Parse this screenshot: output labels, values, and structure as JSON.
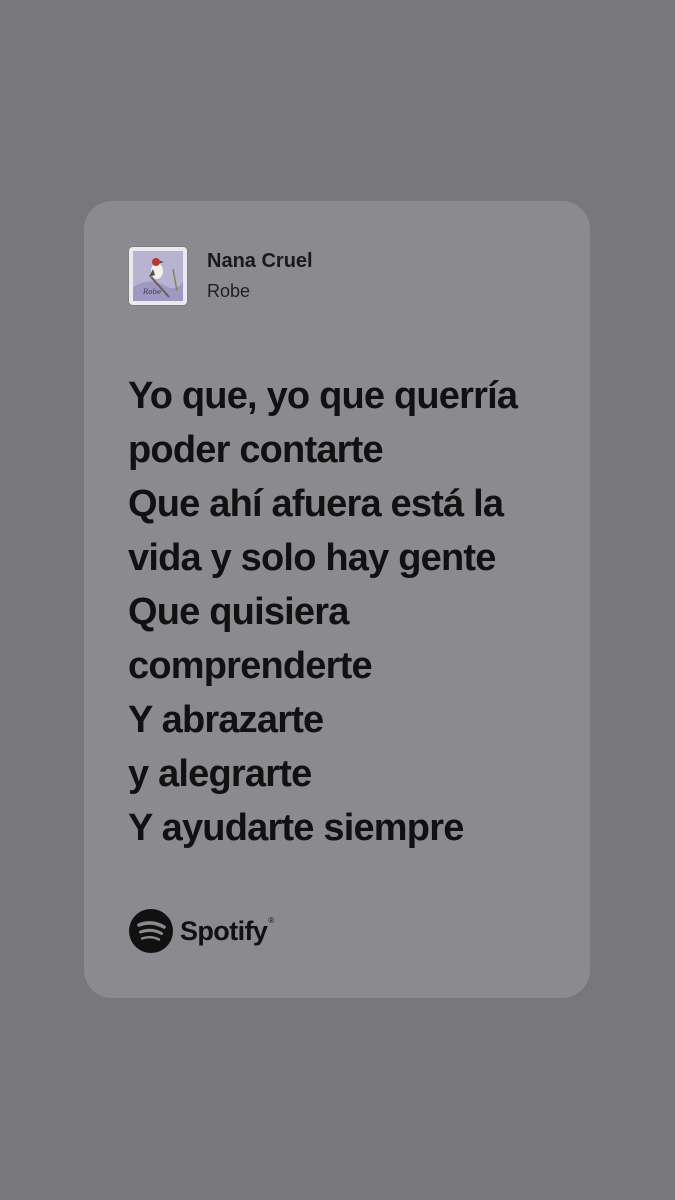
{
  "song": {
    "title": "Nana Cruel",
    "artist": "Robe",
    "cover_text": "Robe"
  },
  "lyrics": [
    "Yo que, yo que querría",
    "poder contarte",
    "Que ahí afuera está la",
    "vida y solo hay gente",
    "Que quisiera",
    "comprenderte",
    "Y abrazarte",
    "y alegrarte",
    "Y ayudarte siempre"
  ],
  "brand": {
    "name": "Spotify",
    "icon": "spotify-logo-icon"
  },
  "colors": {
    "background": "#78777c",
    "card": "#8b8a8f",
    "text": "#111111"
  }
}
